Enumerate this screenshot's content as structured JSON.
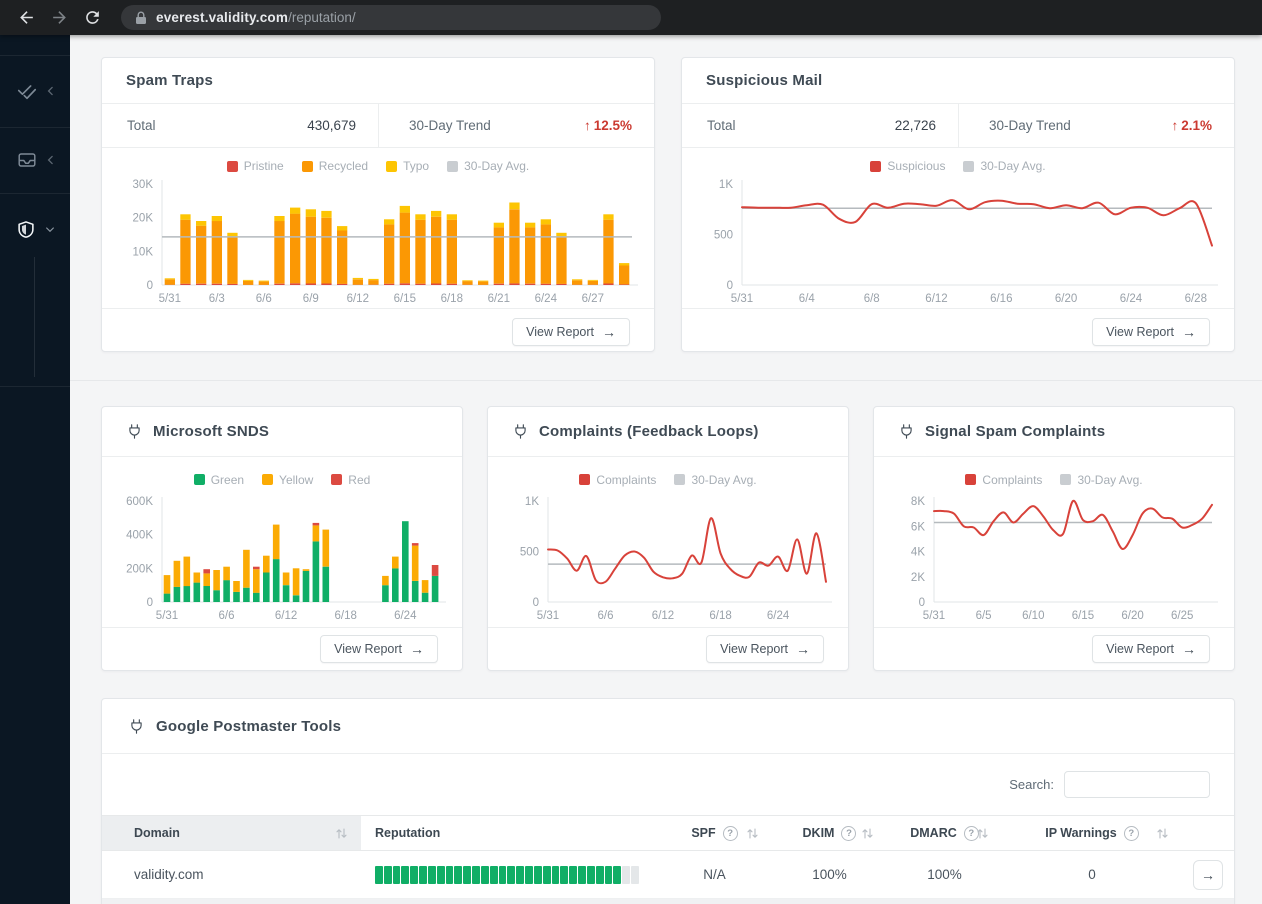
{
  "browser": {
    "host": "everest.validity.com",
    "path": "/reputation/"
  },
  "labels": {
    "total": "Total",
    "trend": "30-Day Trend",
    "view_report": "View Report",
    "search": "Search:"
  },
  "sidebar": {
    "items": [
      {
        "name": "validation",
        "icon": "double-check-icon",
        "active": false
      },
      {
        "name": "inbox",
        "icon": "inbox-icon",
        "active": false
      },
      {
        "name": "reputation",
        "icon": "shield-icon",
        "active": true
      }
    ]
  },
  "cards": {
    "spam_traps": {
      "title": "Spam Traps",
      "total": "430,679",
      "trend": "12.5%"
    },
    "suspicious_mail": {
      "title": "Suspicious Mail",
      "total": "22,726",
      "trend": "2.1%"
    },
    "microsoft_snds": {
      "title": "Microsoft SNDS"
    },
    "complaints_fbl": {
      "title": "Complaints (Feedback Loops)"
    },
    "signal_spam": {
      "title": "Signal Spam Complaints"
    },
    "google_postmaster": {
      "title": "Google Postmaster Tools"
    }
  },
  "colors": {
    "trend_red": "#cb3a31",
    "bar_red": "#dc4a41",
    "bar_orange": "#fb9804",
    "bar_yellow": "#fdc503",
    "line_red": "#d8423a",
    "green": "#10ae66",
    "avg_gray": "#b5babe",
    "sidebar_bg": "#0b1723"
  },
  "chart_data": [
    {
      "id": "spam-traps",
      "title": "Spam Traps",
      "type": "stacked-bar",
      "y_max": 30000,
      "y_ticks": [
        {
          "v": 0,
          "label": "0"
        },
        {
          "v": 10000,
          "label": "10K"
        },
        {
          "v": 20000,
          "label": "20K"
        },
        {
          "v": 30000,
          "label": "30K"
        }
      ],
      "x_ticks": [
        {
          "i": 0,
          "label": "5/31"
        },
        {
          "i": 3,
          "label": "6/3"
        },
        {
          "i": 6,
          "label": "6/6"
        },
        {
          "i": 9,
          "label": "6/9"
        },
        {
          "i": 12,
          "label": "6/12"
        },
        {
          "i": 15,
          "label": "6/15"
        },
        {
          "i": 18,
          "label": "6/18"
        },
        {
          "i": 21,
          "label": "6/21"
        },
        {
          "i": 24,
          "label": "6/24"
        },
        {
          "i": 27,
          "label": "6/27"
        }
      ],
      "series": [
        {
          "name": "Pristine",
          "color": "#dc4a41",
          "values": [
            100,
            400,
            400,
            400,
            350,
            80,
            80,
            400,
            500,
            450,
            450,
            350,
            100,
            100,
            400,
            500,
            400,
            450,
            400,
            80,
            80,
            400,
            500,
            400,
            400,
            350,
            100,
            80,
            450,
            200
          ]
        },
        {
          "name": "Recycled",
          "color": "#fb9804",
          "values": [
            1600,
            19000,
            17200,
            18600,
            13950,
            1120,
            970,
            18600,
            20700,
            19850,
            19550,
            15850,
            1600,
            1350,
            17600,
            21000,
            19000,
            19850,
            19000,
            1070,
            970,
            16700,
            22000,
            16700,
            17600,
            13950,
            1300,
            1140,
            18950,
            5600
          ]
        },
        {
          "name": "Typo",
          "color": "#fdc503",
          "values": [
            300,
            1600,
            1400,
            1500,
            1200,
            300,
            250,
            1500,
            1800,
            2200,
            2000,
            1300,
            400,
            350,
            1500,
            2000,
            1600,
            1700,
            1600,
            250,
            250,
            1400,
            2000,
            1400,
            1500,
            1200,
            300,
            280,
            1600,
            700
          ]
        }
      ],
      "avg": {
        "label": "30-Day Avg.",
        "value": 14300
      }
    },
    {
      "id": "suspicious-mail",
      "title": "Suspicious Mail",
      "type": "line",
      "y_max": 1000,
      "y_ticks": [
        {
          "v": 0,
          "label": "0"
        },
        {
          "v": 500,
          "label": "500"
        },
        {
          "v": 1000,
          "label": "1K"
        }
      ],
      "x_ticks": [
        {
          "i": 0,
          "label": "5/31"
        },
        {
          "i": 4,
          "label": "6/4"
        },
        {
          "i": 8,
          "label": "6/8"
        },
        {
          "i": 12,
          "label": "6/12"
        },
        {
          "i": 16,
          "label": "6/16"
        },
        {
          "i": 20,
          "label": "6/20"
        },
        {
          "i": 24,
          "label": "6/24"
        },
        {
          "i": 28,
          "label": "6/28"
        }
      ],
      "series": [
        {
          "name": "Suspicious",
          "color": "#d8423a",
          "values": [
            770,
            765,
            765,
            765,
            790,
            795,
            655,
            625,
            800,
            765,
            805,
            800,
            785,
            840,
            750,
            820,
            835,
            805,
            800,
            760,
            790,
            760,
            815,
            700,
            765,
            765,
            690,
            760,
            810,
            390
          ]
        }
      ],
      "avg": {
        "label": "30-Day Avg.",
        "value": 760
      }
    },
    {
      "id": "microsoft-snds",
      "title": "Microsoft SNDS",
      "type": "stacked-bar",
      "y_max": 600000,
      "y_ticks": [
        {
          "v": 0,
          "label": "0"
        },
        {
          "v": 200000,
          "label": "200K"
        },
        {
          "v": 400000,
          "label": "400K"
        },
        {
          "v": 600000,
          "label": "600K"
        }
      ],
      "x_ticks": [
        {
          "i": 0,
          "label": "5/31"
        },
        {
          "i": 6,
          "label": "6/6"
        },
        {
          "i": 12,
          "label": "6/12"
        },
        {
          "i": 18,
          "label": "6/18"
        },
        {
          "i": 24,
          "label": "6/24"
        }
      ],
      "series": [
        {
          "name": "Green",
          "color": "#10ae66",
          "values": [
            50000,
            90000,
            95000,
            115000,
            95000,
            70000,
            130000,
            60000,
            85000,
            55000,
            175000,
            255000,
            100000,
            40000,
            185000,
            360000,
            210000,
            0,
            0,
            0,
            0,
            0,
            100000,
            200000,
            480000,
            125000,
            55000,
            155000
          ]
        },
        {
          "name": "Yellow",
          "color": "#fbab04",
          "values": [
            110000,
            155000,
            175000,
            60000,
            75000,
            120000,
            80000,
            65000,
            225000,
            140000,
            100000,
            205000,
            75000,
            160000,
            10000,
            95000,
            220000,
            0,
            0,
            0,
            0,
            0,
            55000,
            70000,
            0,
            210000,
            75000,
            0
          ]
        },
        {
          "name": "Red",
          "color": "#dc4a41",
          "values": [
            0,
            0,
            0,
            0,
            25000,
            0,
            0,
            0,
            0,
            15000,
            0,
            0,
            0,
            0,
            0,
            15000,
            0,
            0,
            0,
            0,
            0,
            0,
            0,
            0,
            0,
            15000,
            0,
            65000
          ]
        }
      ],
      "avg": null
    },
    {
      "id": "complaints-fbl",
      "title": "Complaints (Feedback Loops)",
      "type": "line",
      "y_max": 1000,
      "y_ticks": [
        {
          "v": 0,
          "label": "0"
        },
        {
          "v": 500,
          "label": "500"
        },
        {
          "v": 1000,
          "label": "1K"
        }
      ],
      "x_ticks": [
        {
          "i": 0,
          "label": "5/31"
        },
        {
          "i": 6,
          "label": "6/6"
        },
        {
          "i": 12,
          "label": "6/12"
        },
        {
          "i": 18,
          "label": "6/18"
        },
        {
          "i": 24,
          "label": "6/24"
        }
      ],
      "series": [
        {
          "name": "Complaints",
          "color": "#d8423a",
          "values": [
            520,
            510,
            430,
            310,
            455,
            215,
            200,
            330,
            460,
            500,
            440,
            300,
            245,
            235,
            280,
            460,
            390,
            830,
            480,
            330,
            260,
            250,
            390,
            360,
            450,
            310,
            620,
            280,
            680,
            200
          ]
        }
      ],
      "avg": {
        "label": "30-Day Avg.",
        "value": 375
      }
    },
    {
      "id": "signal-spam",
      "title": "Signal Spam Complaints",
      "type": "line",
      "y_max": 8000,
      "y_ticks": [
        {
          "v": 0,
          "label": "0"
        },
        {
          "v": 2000,
          "label": "2K"
        },
        {
          "v": 4000,
          "label": "4K"
        },
        {
          "v": 6000,
          "label": "6K"
        },
        {
          "v": 8000,
          "label": "8K"
        }
      ],
      "x_ticks": [
        {
          "i": 0,
          "label": "5/31"
        },
        {
          "i": 5,
          "label": "6/5"
        },
        {
          "i": 10,
          "label": "6/10"
        },
        {
          "i": 15,
          "label": "6/15"
        },
        {
          "i": 20,
          "label": "6/20"
        },
        {
          "i": 25,
          "label": "6/25"
        }
      ],
      "series": [
        {
          "name": "Complaints",
          "color": "#d8423a",
          "values": [
            7200,
            7200,
            7000,
            6000,
            5900,
            5300,
            6400,
            7100,
            6300,
            7000,
            7600,
            6800,
            5700,
            5400,
            8000,
            6500,
            6400,
            6900,
            5600,
            4200,
            5300,
            7000,
            7400,
            6700,
            6600,
            5900,
            6100,
            6600,
            7700
          ]
        }
      ],
      "avg": {
        "label": "30-Day Avg.",
        "value": 6300
      }
    }
  ],
  "table": {
    "columns": [
      {
        "label": "Domain"
      },
      {
        "label": "Reputation"
      },
      {
        "label": "SPF"
      },
      {
        "label": "DKIM"
      },
      {
        "label": "DMARC"
      },
      {
        "label": "IP Warnings"
      }
    ],
    "rows": [
      {
        "domain": "validity.com",
        "reputation_segments_total": 30,
        "reputation_segments_filled": 28,
        "spf": "N/A",
        "dkim": "100%",
        "dmarc": "100%",
        "ip_warnings": "0"
      }
    ]
  }
}
